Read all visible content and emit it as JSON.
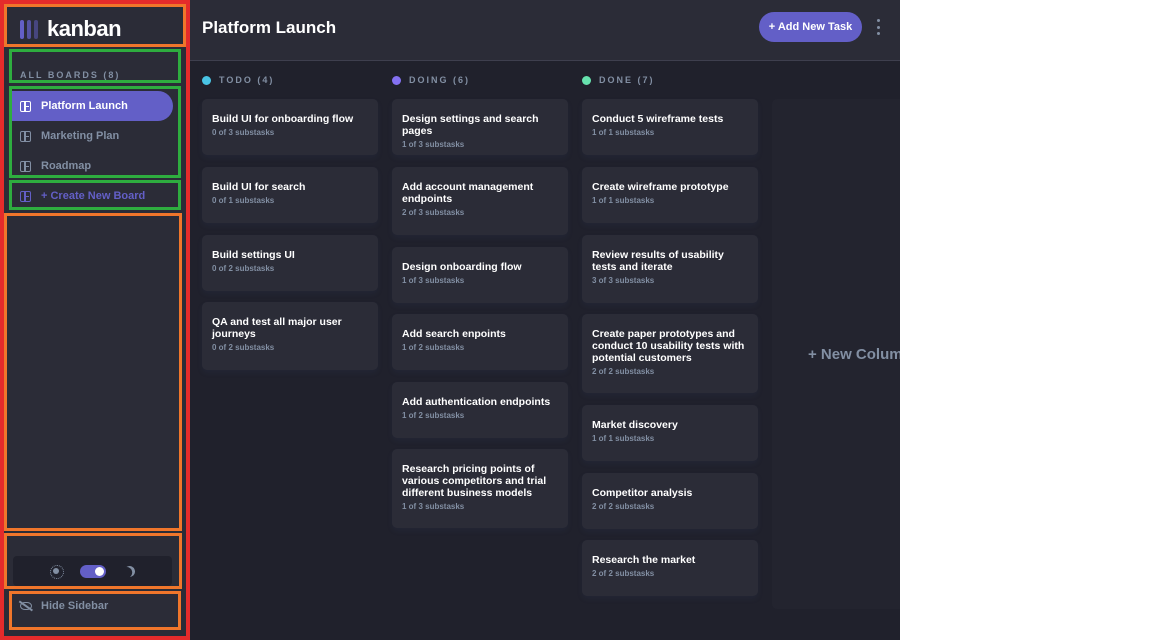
{
  "app": {
    "logo_text": "kanban",
    "accent_color": "#635FC7"
  },
  "sidebar": {
    "all_boards_label": "ALL BOARDS (8)",
    "boards": [
      {
        "label": "Platform Launch",
        "active": true
      },
      {
        "label": "Marketing Plan",
        "active": false
      },
      {
        "label": "Roadmap",
        "active": false
      }
    ],
    "create_board_label": "+ Create New Board",
    "hide_sidebar_label": "Hide Sidebar",
    "theme": "dark"
  },
  "header": {
    "board_title": "Platform Launch",
    "add_task_label": "+ Add New Task"
  },
  "columns": [
    {
      "name": "TODO (4)",
      "color": "#49C4E5",
      "tasks": [
        {
          "title": "Build UI for onboarding flow",
          "subtasks": "0 of 3 substasks"
        },
        {
          "title": "Build UI for search",
          "subtasks": "0 of 1 substasks"
        },
        {
          "title": "Build settings UI",
          "subtasks": "0 of 2 substasks"
        },
        {
          "title": "QA and test all major user journeys",
          "subtasks": "0 of 2 substasks"
        }
      ]
    },
    {
      "name": "DOING (6)",
      "color": "#8471F2",
      "tasks": [
        {
          "title": "Design settings and search pages",
          "subtasks": "1 of 3 substasks"
        },
        {
          "title": "Add account management endpoints",
          "subtasks": "2 of 3 substasks"
        },
        {
          "title": "Design onboarding flow",
          "subtasks": "1 of 3 substasks"
        },
        {
          "title": "Add search enpoints",
          "subtasks": "1 of 2 substasks"
        },
        {
          "title": "Add authentication endpoints",
          "subtasks": "1 of 2 substasks"
        },
        {
          "title": "Research pricing points of various competitors and trial different business models",
          "subtasks": "1 of 3 substasks"
        }
      ]
    },
    {
      "name": "DONE (7)",
      "color": "#67E2AE",
      "tasks": [
        {
          "title": "Conduct 5 wireframe tests",
          "subtasks": "1 of 1 substasks"
        },
        {
          "title": "Create wireframe prototype",
          "subtasks": "1 of 1 substasks"
        },
        {
          "title": "Review results of usability tests and iterate",
          "subtasks": "3 of 3 substasks"
        },
        {
          "title": "Create paper prototypes and conduct 10 usability tests with potential customers",
          "subtasks": "2 of 2 substasks"
        },
        {
          "title": "Market discovery",
          "subtasks": "1 of 1 substasks"
        },
        {
          "title": "Competitor analysis",
          "subtasks": "2 of 2 substasks"
        },
        {
          "title": "Research the market",
          "subtasks": "2 of 2 substasks"
        }
      ]
    }
  ],
  "new_column_label": "+ New Column"
}
